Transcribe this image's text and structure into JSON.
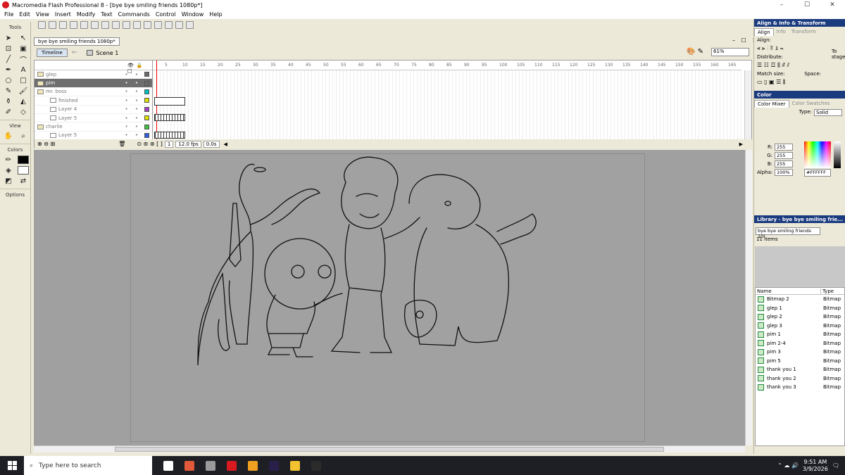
{
  "window": {
    "title": "Macromedia Flash Professional 8 - [bye bye smiling friends 1080p*]",
    "controls": [
      "–",
      "☐",
      "✕"
    ]
  },
  "menu": [
    "File",
    "Edit",
    "View",
    "Insert",
    "Modify",
    "Text",
    "Commands",
    "Control",
    "Window",
    "Help"
  ],
  "tools_panel": {
    "header": "Tools",
    "section_view": "View",
    "section_colors": "Colors",
    "section_options": "Options"
  },
  "document": {
    "tab": "bye bye smiling friends 1080p*",
    "timeline_button": "Timeline",
    "scene": "Scene 1",
    "zoom": "61%"
  },
  "timeline": {
    "layers": [
      {
        "name": "glep",
        "type": "folder",
        "color": "#6b6b6b",
        "selected": false
      },
      {
        "name": "pim",
        "type": "folder",
        "color": "#6b6b6b",
        "selected": true
      },
      {
        "name": "mr. boss",
        "type": "folder",
        "color": "#00c0c0",
        "selected": false
      },
      {
        "name": "finished",
        "type": "layer",
        "color": "#e0e000",
        "selected": false
      },
      {
        "name": "Layer 4",
        "type": "layer",
        "color": "#a040c0",
        "selected": false
      },
      {
        "name": "Layer 5",
        "type": "layer",
        "color": "#e0e000",
        "selected": false
      },
      {
        "name": "charlie",
        "type": "folder",
        "color": "#40c040",
        "selected": false
      },
      {
        "name": "Layer 5",
        "type": "layer",
        "color": "#3060e0",
        "selected": false
      }
    ],
    "frame_numbers": [
      "5",
      "10",
      "15",
      "20",
      "25",
      "30",
      "35",
      "40",
      "45",
      "50",
      "55",
      "60",
      "65",
      "70",
      "75",
      "80",
      "85",
      "90",
      "95",
      "100",
      "105",
      "110",
      "115",
      "120",
      "125",
      "130",
      "135",
      "140",
      "145",
      "150",
      "155",
      "160",
      "165"
    ],
    "current_frame": "1",
    "fps": "12.0 fps",
    "time": "0.0s"
  },
  "align_panel": {
    "title": "Align & Info & Transform",
    "tabs": [
      "Align",
      "Info",
      "Transform"
    ],
    "align_label": "Align:",
    "distribute_label": "Distribute:",
    "match_size_label": "Match size:",
    "space_label": "Space:",
    "to_stage": "To stage:"
  },
  "color_panel": {
    "title": "Color",
    "tabs": [
      "Color Mixer",
      "Color Swatches"
    ],
    "type_label": "Type:",
    "type_value": "Solid",
    "r_label": "R:",
    "r": "255",
    "g_label": "G:",
    "g": "255",
    "b_label": "B:",
    "b": "255",
    "alpha_label": "Alpha:",
    "alpha": "100%",
    "hex": "#FFFFFF"
  },
  "library_panel": {
    "title": "Library - bye bye smiling frie...",
    "doc_select": "bye bye smiling friends 10(",
    "count": "11 items",
    "columns": [
      "Name",
      "Type"
    ],
    "items": [
      {
        "name": "Bitmap 2",
        "type": "Bitmap"
      },
      {
        "name": "glep 1",
        "type": "Bitmap"
      },
      {
        "name": "glep 2",
        "type": "Bitmap"
      },
      {
        "name": "glep 3",
        "type": "Bitmap"
      },
      {
        "name": "pim 1",
        "type": "Bitmap"
      },
      {
        "name": "pim 2-4",
        "type": "Bitmap"
      },
      {
        "name": "pim 3",
        "type": "Bitmap"
      },
      {
        "name": "pim 5",
        "type": "Bitmap"
      },
      {
        "name": "thank you 1",
        "type": "Bitmap"
      },
      {
        "name": "thank you 2",
        "type": "Bitmap"
      },
      {
        "name": "thank you 3",
        "type": "Bitmap"
      }
    ]
  },
  "taskbar": {
    "search_placeholder": "Type here to search",
    "apps": [
      {
        "icon": "task-view-icon",
        "color": "#ffffff"
      },
      {
        "icon": "smiling-app-icon",
        "color": "#e05a3a"
      },
      {
        "icon": "file-explorer-grey-icon",
        "color": "#9a9a9a"
      },
      {
        "icon": "flash-icon",
        "color": "#d71920"
      },
      {
        "icon": "media-icon",
        "color": "#f0a020"
      },
      {
        "icon": "after-effects-icon",
        "color": "#2a1f4a"
      },
      {
        "icon": "folder-icon",
        "color": "#f2c230"
      },
      {
        "icon": "star-app-icon",
        "color": "#2b2b2b"
      }
    ],
    "time": "9:51 AM",
    "date": "3/9/2026"
  }
}
